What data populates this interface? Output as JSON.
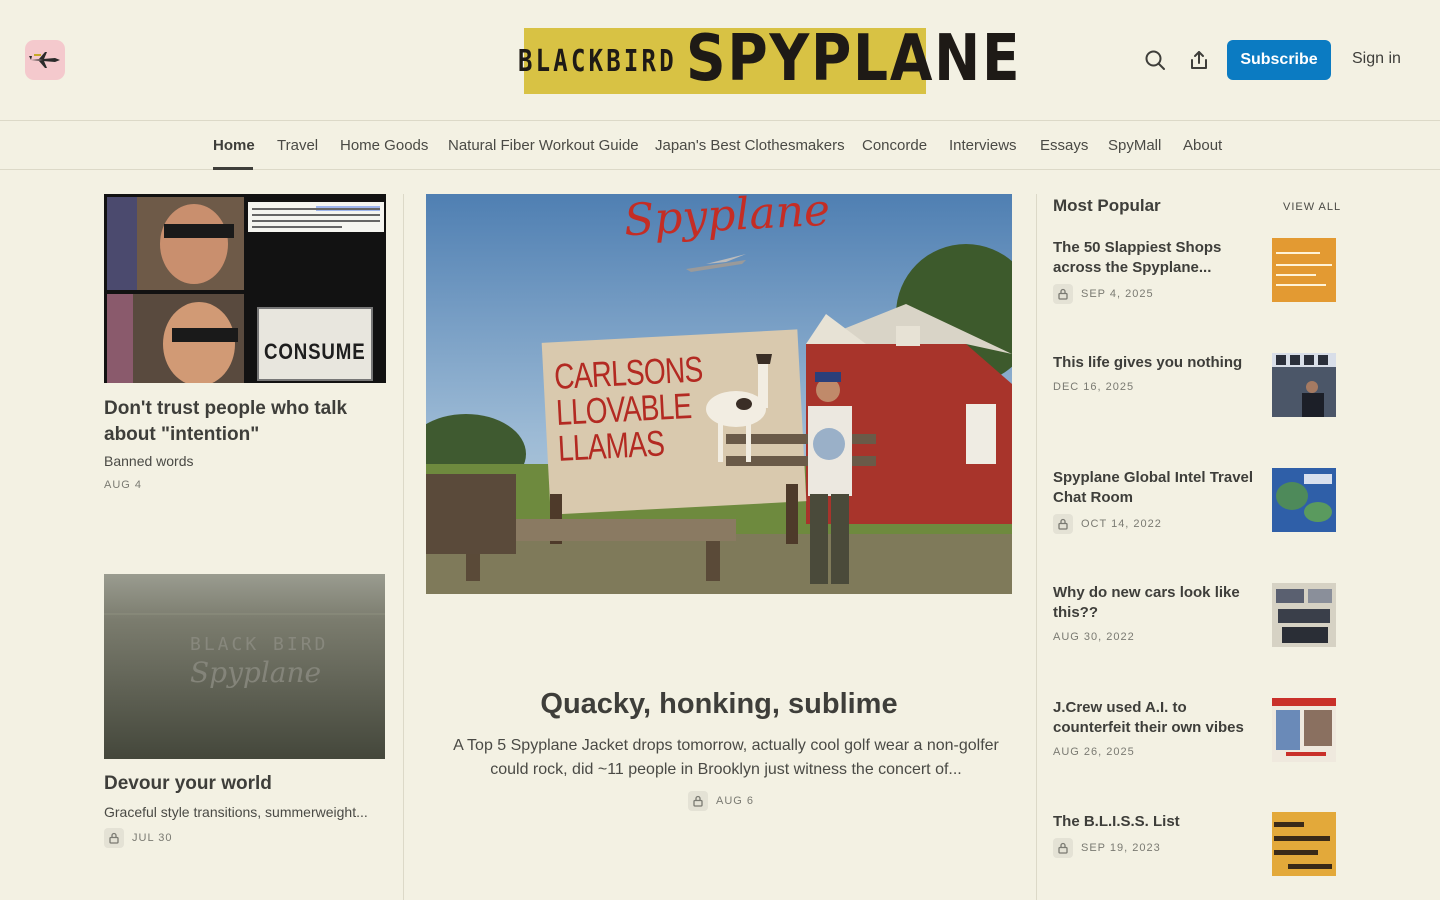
{
  "header": {
    "site_icon": "spyplane-icon",
    "logo_left": "BLACKBIRD",
    "logo_right": "SPYPLANE",
    "subscribe_label": "Subscribe",
    "signin_label": "Sign in",
    "accent": "#0b7bc2"
  },
  "nav": {
    "items": [
      {
        "label": "Home"
      },
      {
        "label": "Travel"
      },
      {
        "label": "Home Goods"
      },
      {
        "label": "Natural Fiber Workout Guide"
      },
      {
        "label": "Japan's Best Clothesmakers"
      },
      {
        "label": "Concorde"
      },
      {
        "label": "Interviews"
      },
      {
        "label": "Essays"
      },
      {
        "label": "SpyMall"
      },
      {
        "label": "About"
      }
    ]
  },
  "left": {
    "post1": {
      "title": "Don't trust people who talk about \"intention\"",
      "subtitle": "Banned words",
      "date": "AUG 4",
      "thumb_text": "CONSUME"
    },
    "post2": {
      "title": "Devour your world",
      "subtitle": "Graceful style transitions, summerweight...",
      "date": "JUL 30",
      "thumb_text_1": "BLACK BIRD",
      "thumb_text_2": "Spyplane"
    }
  },
  "featured": {
    "title": "Quacky, honking, sublime",
    "subtitle": "A Top 5 Spyplane Jacket drops tomorrow, actually cool golf wear a non-golfer could rock, did ~11 people in Brooklyn just witness the concert of...",
    "date": "AUG 6",
    "image_script": "Spyplane",
    "sign_lines": [
      "CARLSONS",
      "LLOVABLE",
      "LLAMAS"
    ]
  },
  "popular": {
    "heading": "Most Popular",
    "view_all": "VIEW ALL",
    "items": [
      {
        "title": "The 50 Slappiest Shops across the Spyplane...",
        "date": "SEP 4, 2025",
        "locked": true
      },
      {
        "title": "This life gives you nothing",
        "date": "DEC 16, 2025",
        "locked": false
      },
      {
        "title": "Spyplane Global Intel Travel Chat Room",
        "date": "OCT 14, 2022",
        "locked": true
      },
      {
        "title": "Why do new cars look like this??",
        "date": "AUG 30, 2022",
        "locked": false
      },
      {
        "title": "J.Crew used A.I. to counterfeit their own vibes",
        "date": "AUG 26, 2025",
        "locked": false
      },
      {
        "title": "The B.L.I.S.S. List",
        "date": "SEP 19, 2023",
        "locked": true
      }
    ]
  },
  "colors": {
    "background": "#f3f1e3",
    "text": "#3e3e3a",
    "logo_band": "#d8c244"
  }
}
